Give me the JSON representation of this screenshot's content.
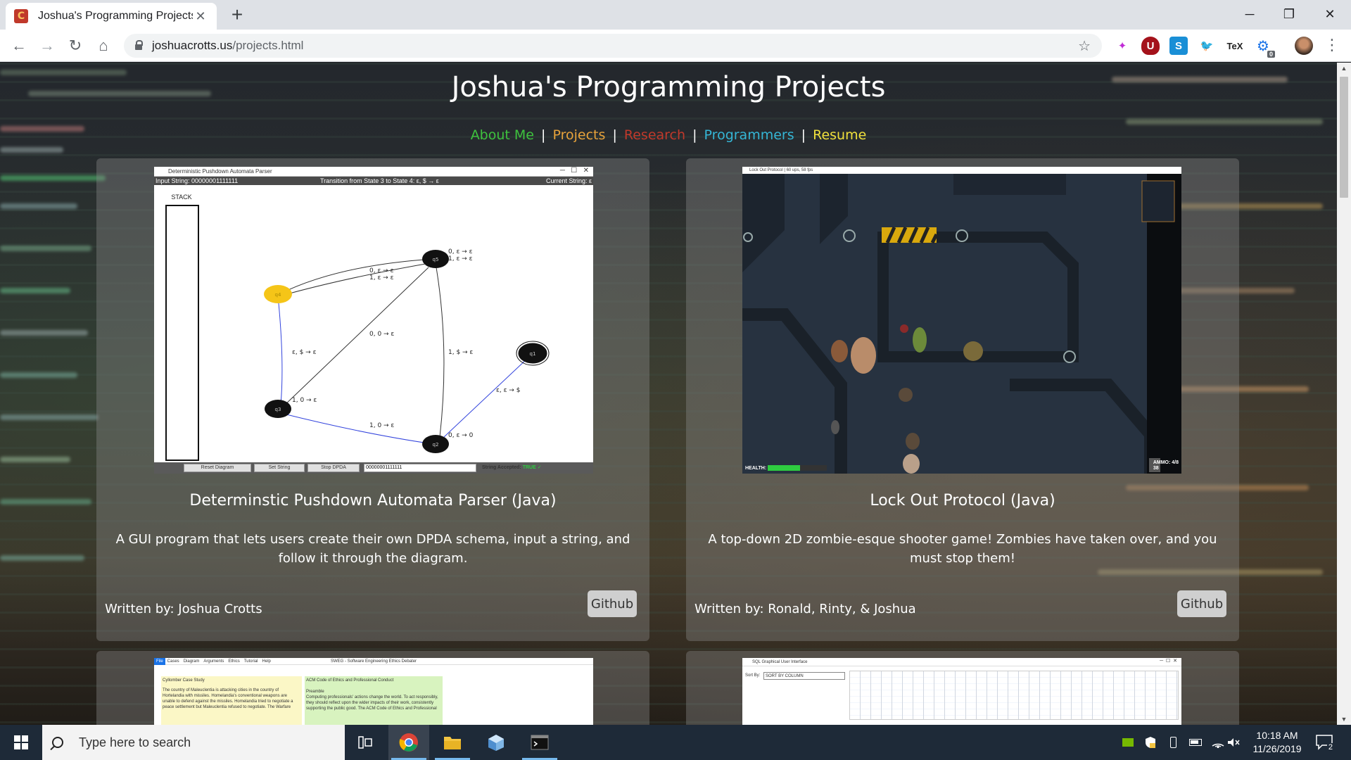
{
  "browser": {
    "tab_title": "Joshua's Programming Projects",
    "tab_close": "✕",
    "new_tab": "+",
    "url_host": "joshuacrotts.us",
    "url_path": "/projects.html",
    "window_controls": {
      "minimize": "─",
      "maximize": "❐",
      "close": "✕"
    },
    "extensions": [
      "pen-extension-icon",
      "ublock-icon",
      "s-extension-icon",
      "bird-extension-icon",
      "tex-extension-icon",
      "puzzle-extension-icon"
    ],
    "extension_labels": [
      "✦",
      "U",
      "S",
      "🐦",
      "TeX",
      "⚙"
    ],
    "extension_badge": "0"
  },
  "page": {
    "title": "Joshua's Programming Projects",
    "nav": [
      {
        "label": "About Me",
        "color": "#3ec23e"
      },
      {
        "label": "Projects",
        "color": "#e8a33b"
      },
      {
        "label": "Research",
        "color": "#c0392b"
      },
      {
        "label": "Programmers",
        "color": "#35b6d6"
      },
      {
        "label": "Resume",
        "color": "#f0e03c"
      }
    ],
    "separator": "|"
  },
  "projects": [
    {
      "title": "Determinstic Pushdown Automata Parser (Java)",
      "description": "A GUI program that lets users create their own DPDA schema, input a string, and follow it through the diagram.",
      "author": "Written by: Joshua Crotts",
      "button": "Github"
    },
    {
      "title": "Lock Out Protocol (Java)",
      "description": "A top-down 2D zombie-esque shooter game! Zombies have taken over, and you must stop them!",
      "author": "Written by: Ronald, Rinty, & Joshua",
      "button": "Github"
    }
  ],
  "dpda_screenshot": {
    "window_title": "Deterministic Pushdown Automata Parser",
    "input_label": "Input String: 00000001111111",
    "transition_label": "Transition from State 3 to State 4: ε, $ → ε",
    "current_label": "Current String: ε",
    "stack_label": "STACK",
    "states": [
      "q4",
      "q5",
      "q1",
      "q3",
      "q2"
    ],
    "edge_labels": [
      "0, ε → ε",
      "1, ε → ε",
      "0, ε → ε",
      "1, ε → ε",
      "ε, $ → ε",
      "0, 0 → ε",
      "1, $ → ε",
      "ε, ε → $",
      "1, 0 → ε",
      "1, 0 → ε",
      "0, ε → 0"
    ],
    "buttons": [
      "Reset Diagram",
      "Set String",
      "Stop DPDA"
    ],
    "input_value": "00000001111111",
    "accepted_label": "String Accepted:",
    "accepted_value": "TRUE ✓"
  },
  "game_screenshot": {
    "window_title": "Lock Out Protocol | 60 ups, 58 fps",
    "health_label": "HEALTH:",
    "health_fraction": 0.55,
    "ammo_label": "AMMO: 4/8",
    "ammo_sub": "38"
  },
  "bottom_screenshots": {
    "left_title": "SWEG - Software Engineering Ethics Debater",
    "left_menu": [
      "File",
      "Cases",
      "Diagram",
      "Arguments",
      "Ethics",
      "Tutorial",
      "Help"
    ],
    "left_case": "Cyllomber Case Study",
    "left_case_text": "The country of Maleuclentia is attacking cities in the country of Hortelandia with missiles. Homelandia's conventional weapons are unable to defend against the missiles. Homelandia tried to negotiate a peace settlement but Maleuclentia refused to negotiate. The Warfare",
    "left_code_title": "ACM Code of Ethics and Professional Conduct",
    "left_code_text": "Preamble",
    "left_code_body": "Computing professionals' actions change the world. To act responsibly, they should reflect upon the wider impacts of their work, consistently supporting the public good. The ACM Code of Ethics and Professional",
    "right_title": "SQL Graphical User Interface",
    "right_sort_label": "Sort By:",
    "right_sort_value": "SORT BY COLUMN"
  },
  "taskbar": {
    "search_placeholder": "Type here to search",
    "time": "10:18 AM",
    "date": "11/26/2019",
    "notification_count": "2",
    "apps": [
      "task-view-icon",
      "chrome-icon",
      "file-explorer-icon",
      "3d-viewer-icon",
      "terminal-icon"
    ]
  },
  "colors": {
    "accent_tab_favicon": "#c0392b",
    "taskbar": "#1e2a38",
    "node_highlight": "#f5c518"
  }
}
